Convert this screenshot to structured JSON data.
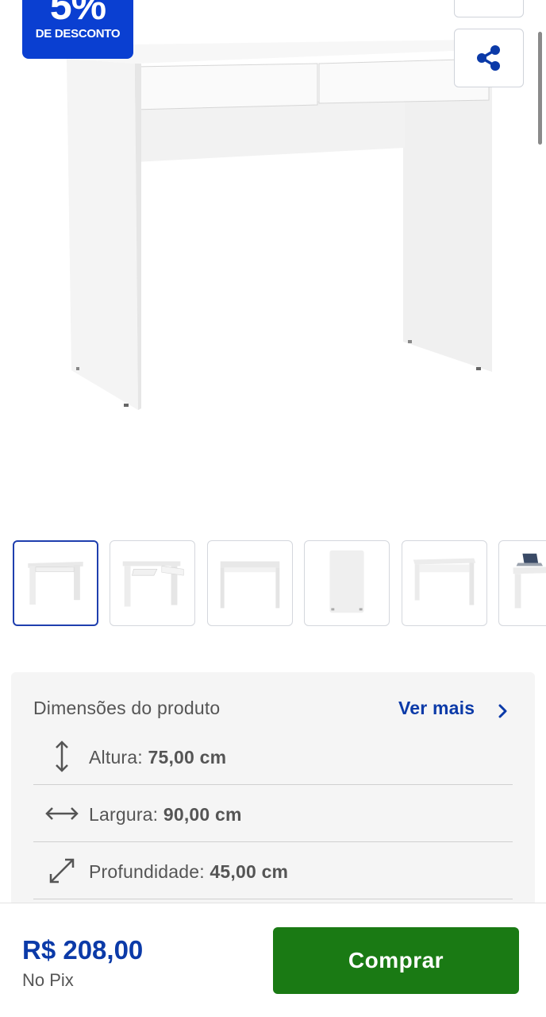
{
  "badge": {
    "value": "5%",
    "label": "DE DESCONTO"
  },
  "icons": {
    "share": "share-icon",
    "chevron": "chevron-right-icon",
    "height": "vertical-arrows-icon",
    "width": "horizontal-arrows-icon",
    "depth": "diagonal-arrows-icon"
  },
  "thumbnails": [
    {
      "name": "desk-front",
      "active": true
    },
    {
      "name": "desk-drawer-open",
      "active": false
    },
    {
      "name": "desk-front-plain",
      "active": false
    },
    {
      "name": "desk-side",
      "active": false
    },
    {
      "name": "desk-angle",
      "active": false
    },
    {
      "name": "desk-with-laptop",
      "active": false
    }
  ],
  "dimensions": {
    "title": "Dimensões do produto",
    "more": "Ver mais",
    "rows": [
      {
        "label": "Altura: ",
        "value": "75,00 cm"
      },
      {
        "label": "Largura: ",
        "value": "90,00 cm"
      },
      {
        "label": "Profundidade: ",
        "value": "45,00 cm"
      }
    ]
  },
  "footer": {
    "price": "R$ 208,00",
    "price_note": "No Pix",
    "buy_label": "Comprar"
  },
  "colors": {
    "brand_blue": "#0a3fd1",
    "link_blue": "#0b3aa8",
    "buy_green": "#1a7a14"
  }
}
